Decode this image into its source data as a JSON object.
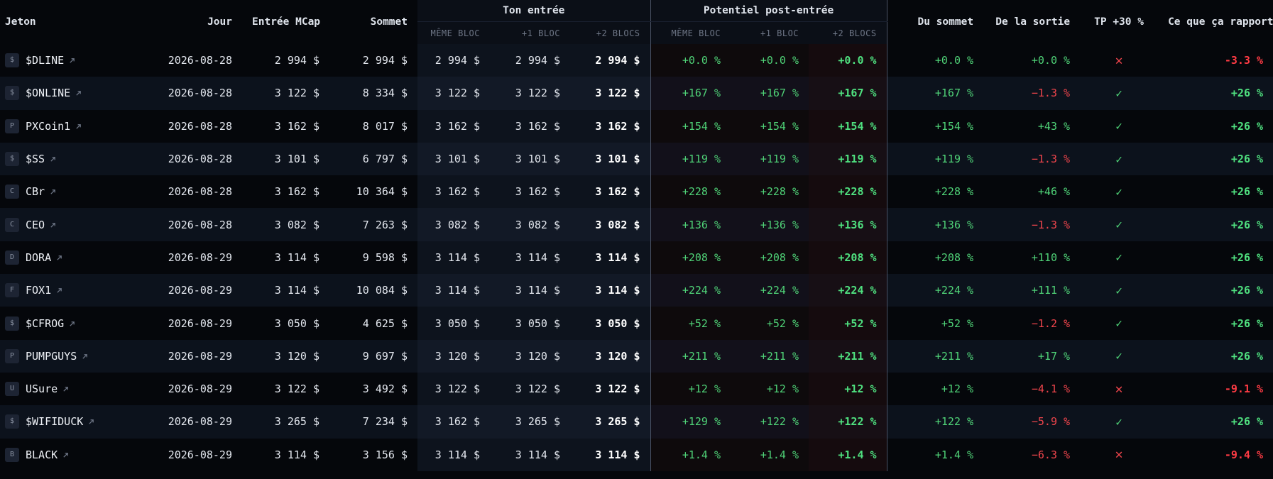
{
  "headers": {
    "jeton": "Jeton",
    "jour": "Jour",
    "entree_mcap": "Entrée MCap",
    "sommet": "Sommet",
    "ton_entree": "Ton entrée",
    "potentiel": "Potentiel post-entrée",
    "du_sommet": "Du sommet",
    "de_la_sortie": "De la sortie",
    "tp": "TP +30 %",
    "rapporte": "Ce que ça rapporte",
    "meme_bloc": "MÊME BLOC",
    "plus1_bloc": "+1 BLOC",
    "plus2_blocs": "+2 BLOCS"
  },
  "colors": {
    "green": "#4fd277",
    "red": "#f0454c",
    "background": "#05070b"
  },
  "icons": {
    "external_link": "external-link-icon",
    "tp_hit": "check-icon",
    "tp_miss": "cross-icon"
  },
  "rows": [
    {
      "badge": "$",
      "name": "$DLINE",
      "day": "2026-08-28",
      "mcap": "2 994 $",
      "peak": "2 994 $",
      "e0": "2 994 $",
      "e1": "2 994 $",
      "e2": "2 994 $",
      "p0": "+0.0 %",
      "p1": "+0.0 %",
      "p2": "+0.0 %",
      "from_peak": "+0.0 %",
      "exit": "+0.0 %",
      "exit_neg": false,
      "tp": false,
      "result": "-3.3 %",
      "result_neg": true
    },
    {
      "badge": "$",
      "name": "$ONLINE",
      "day": "2026-08-28",
      "mcap": "3 122 $",
      "peak": "8 334 $",
      "e0": "3 122 $",
      "e1": "3 122 $",
      "e2": "3 122 $",
      "p0": "+167 %",
      "p1": "+167 %",
      "p2": "+167 %",
      "from_peak": "+167 %",
      "exit": "−1.3 %",
      "exit_neg": true,
      "tp": true,
      "result": "+26 %",
      "result_neg": false
    },
    {
      "badge": "P",
      "name": "PXCoin1",
      "day": "2026-08-28",
      "mcap": "3 162 $",
      "peak": "8 017 $",
      "e0": "3 162 $",
      "e1": "3 162 $",
      "e2": "3 162 $",
      "p0": "+154 %",
      "p1": "+154 %",
      "p2": "+154 %",
      "from_peak": "+154 %",
      "exit": "+43 %",
      "exit_neg": false,
      "tp": true,
      "result": "+26 %",
      "result_neg": false
    },
    {
      "badge": "$",
      "name": "$SS",
      "day": "2026-08-28",
      "mcap": "3 101 $",
      "peak": "6 797 $",
      "e0": "3 101 $",
      "e1": "3 101 $",
      "e2": "3 101 $",
      "p0": "+119 %",
      "p1": "+119 %",
      "p2": "+119 %",
      "from_peak": "+119 %",
      "exit": "−1.3 %",
      "exit_neg": true,
      "tp": true,
      "result": "+26 %",
      "result_neg": false
    },
    {
      "badge": "C",
      "name": "CBr",
      "day": "2026-08-28",
      "mcap": "3 162 $",
      "peak": "10 364 $",
      "e0": "3 162 $",
      "e1": "3 162 $",
      "e2": "3 162 $",
      "p0": "+228 %",
      "p1": "+228 %",
      "p2": "+228 %",
      "from_peak": "+228 %",
      "exit": "+46 %",
      "exit_neg": false,
      "tp": true,
      "result": "+26 %",
      "result_neg": false
    },
    {
      "badge": "C",
      "name": "CEO",
      "day": "2026-08-28",
      "mcap": "3 082 $",
      "peak": "7 263 $",
      "e0": "3 082 $",
      "e1": "3 082 $",
      "e2": "3 082 $",
      "p0": "+136 %",
      "p1": "+136 %",
      "p2": "+136 %",
      "from_peak": "+136 %",
      "exit": "−1.3 %",
      "exit_neg": true,
      "tp": true,
      "result": "+26 %",
      "result_neg": false
    },
    {
      "badge": "D",
      "name": "DORA",
      "day": "2026-08-29",
      "mcap": "3 114 $",
      "peak": "9 598 $",
      "e0": "3 114 $",
      "e1": "3 114 $",
      "e2": "3 114 $",
      "p0": "+208 %",
      "p1": "+208 %",
      "p2": "+208 %",
      "from_peak": "+208 %",
      "exit": "+110 %",
      "exit_neg": false,
      "tp": true,
      "result": "+26 %",
      "result_neg": false
    },
    {
      "badge": "F",
      "name": "FOX1",
      "day": "2026-08-29",
      "mcap": "3 114 $",
      "peak": "10 084 $",
      "e0": "3 114 $",
      "e1": "3 114 $",
      "e2": "3 114 $",
      "p0": "+224 %",
      "p1": "+224 %",
      "p2": "+224 %",
      "from_peak": "+224 %",
      "exit": "+111 %",
      "exit_neg": false,
      "tp": true,
      "result": "+26 %",
      "result_neg": false
    },
    {
      "badge": "$",
      "name": "$CFROG",
      "day": "2026-08-29",
      "mcap": "3 050 $",
      "peak": "4 625 $",
      "e0": "3 050 $",
      "e1": "3 050 $",
      "e2": "3 050 $",
      "p0": "+52 %",
      "p1": "+52 %",
      "p2": "+52 %",
      "from_peak": "+52 %",
      "exit": "−1.2 %",
      "exit_neg": true,
      "tp": true,
      "result": "+26 %",
      "result_neg": false
    },
    {
      "badge": "P",
      "name": "PUMPGUYS",
      "day": "2026-08-29",
      "mcap": "3 120 $",
      "peak": "9 697 $",
      "e0": "3 120 $",
      "e1": "3 120 $",
      "e2": "3 120 $",
      "p0": "+211 %",
      "p1": "+211 %",
      "p2": "+211 %",
      "from_peak": "+211 %",
      "exit": "+17 %",
      "exit_neg": false,
      "tp": true,
      "result": "+26 %",
      "result_neg": false
    },
    {
      "badge": "U",
      "name": "USure",
      "day": "2026-08-29",
      "mcap": "3 122 $",
      "peak": "3 492 $",
      "e0": "3 122 $",
      "e1": "3 122 $",
      "e2": "3 122 $",
      "p0": "+12 %",
      "p1": "+12 %",
      "p2": "+12 %",
      "from_peak": "+12 %",
      "exit": "−4.1 %",
      "exit_neg": true,
      "tp": false,
      "result": "-9.1 %",
      "result_neg": true
    },
    {
      "badge": "$",
      "name": "$WIFIDUCK",
      "day": "2026-08-29",
      "mcap": "3 265 $",
      "peak": "7 234 $",
      "e0": "3 162 $",
      "e1": "3 265 $",
      "e2": "3 265 $",
      "p0": "+129 %",
      "p1": "+122 %",
      "p2": "+122 %",
      "from_peak": "+122 %",
      "exit": "−5.9 %",
      "exit_neg": true,
      "tp": true,
      "result": "+26 %",
      "result_neg": false
    },
    {
      "badge": "B",
      "name": "BLACK",
      "day": "2026-08-29",
      "mcap": "3 114 $",
      "peak": "3 156 $",
      "e0": "3 114 $",
      "e1": "3 114 $",
      "e2": "3 114 $",
      "p0": "+1.4 %",
      "p1": "+1.4 %",
      "p2": "+1.4 %",
      "from_peak": "+1.4 %",
      "exit": "−6.3 %",
      "exit_neg": true,
      "tp": false,
      "result": "-9.4 %",
      "result_neg": true
    }
  ]
}
